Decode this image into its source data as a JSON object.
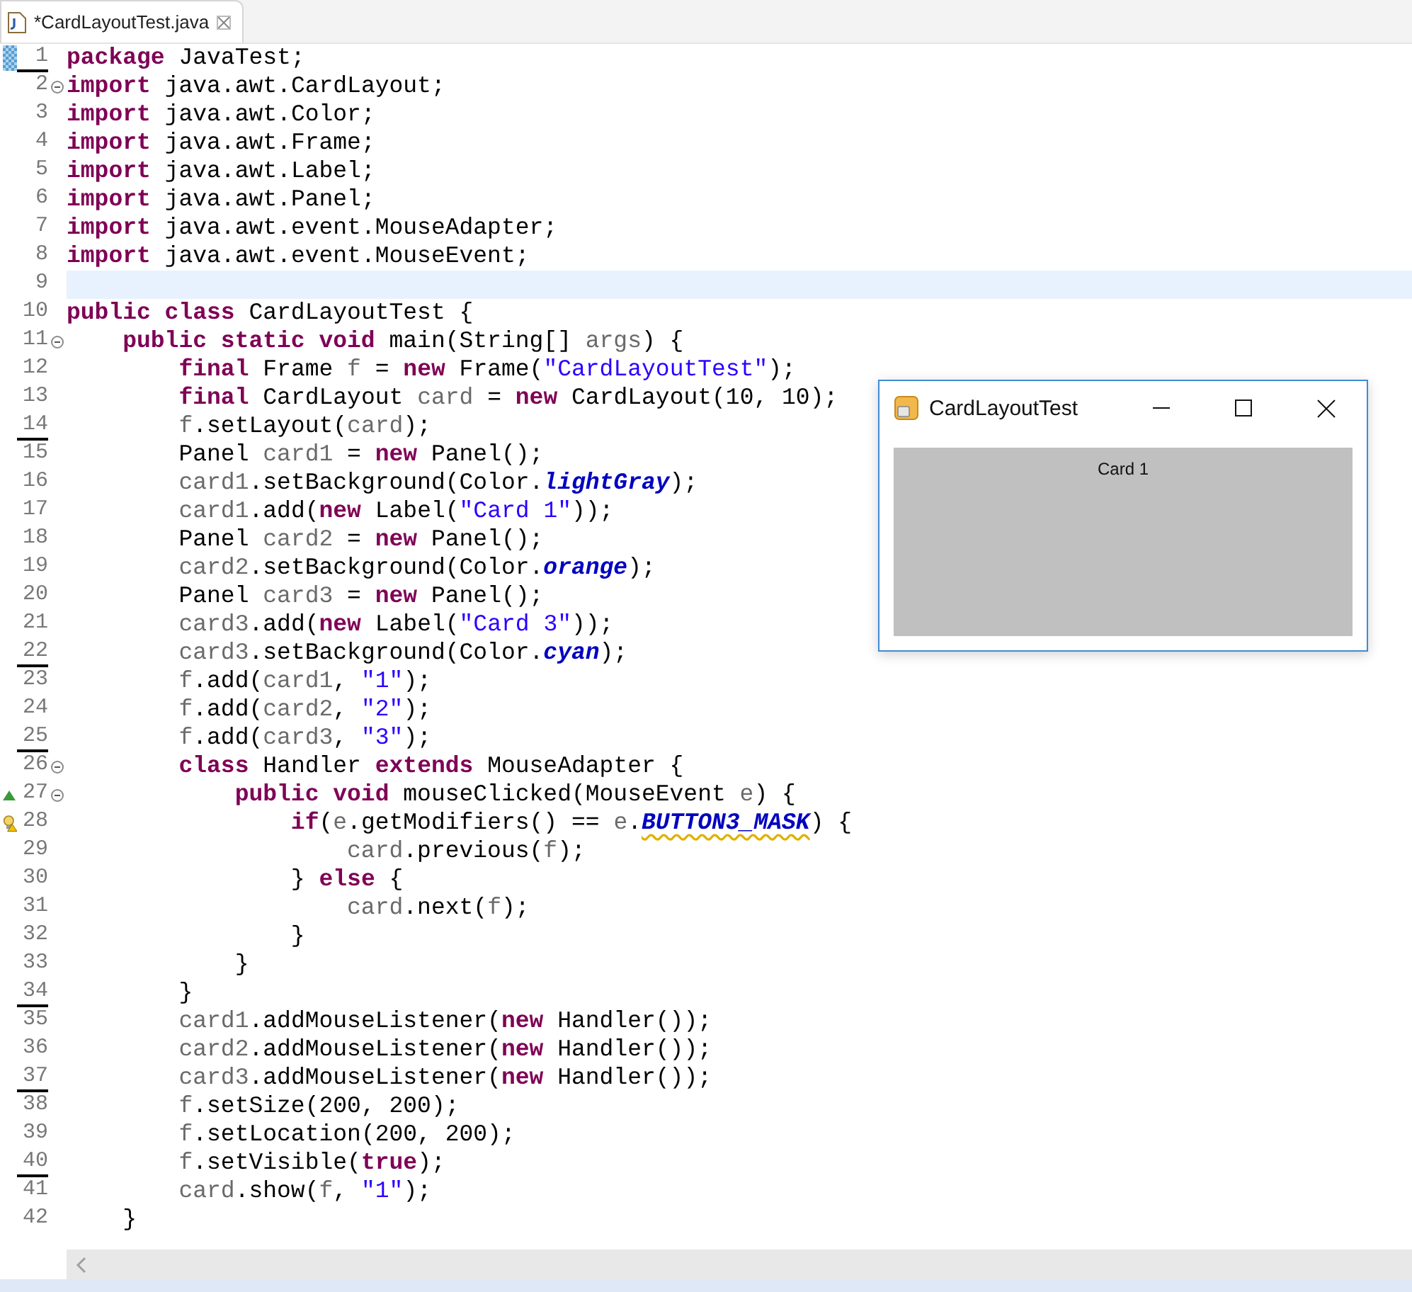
{
  "editor_tab": {
    "title": "*CardLayoutTest.java"
  },
  "lines": [
    {
      "number": "1",
      "underlined": true,
      "fold": false,
      "current": false,
      "marker": {
        "kind": "highlight"
      },
      "tokens": [
        {
          "kind": "keyword",
          "text": "package"
        },
        {
          "kind": "plain",
          "text": " JavaTest;"
        }
      ]
    },
    {
      "number": "2",
      "underlined": false,
      "fold": true,
      "current": false,
      "tokens": [
        {
          "kind": "keyword",
          "text": "import"
        },
        {
          "kind": "plain",
          "text": " java.awt.CardLayout;"
        }
      ]
    },
    {
      "number": "3",
      "underlined": false,
      "fold": false,
      "current": false,
      "tokens": [
        {
          "kind": "keyword",
          "text": "import"
        },
        {
          "kind": "plain",
          "text": " java.awt.Color;"
        }
      ]
    },
    {
      "number": "4",
      "underlined": false,
      "fold": false,
      "current": false,
      "tokens": [
        {
          "kind": "keyword",
          "text": "import"
        },
        {
          "kind": "plain",
          "text": " java.awt.Frame;"
        }
      ]
    },
    {
      "number": "5",
      "underlined": false,
      "fold": false,
      "current": false,
      "tokens": [
        {
          "kind": "keyword",
          "text": "import"
        },
        {
          "kind": "plain",
          "text": " java.awt.Label;"
        }
      ]
    },
    {
      "number": "6",
      "underlined": false,
      "fold": false,
      "current": false,
      "tokens": [
        {
          "kind": "keyword",
          "text": "import"
        },
        {
          "kind": "plain",
          "text": " java.awt.Panel;"
        }
      ]
    },
    {
      "number": "7",
      "underlined": false,
      "fold": false,
      "current": false,
      "tokens": [
        {
          "kind": "keyword",
          "text": "import"
        },
        {
          "kind": "plain",
          "text": " java.awt.event.MouseAdapter;"
        }
      ]
    },
    {
      "number": "8",
      "underlined": false,
      "fold": false,
      "current": false,
      "tokens": [
        {
          "kind": "keyword",
          "text": "import"
        },
        {
          "kind": "plain",
          "text": " java.awt.event.MouseEvent;"
        }
      ]
    },
    {
      "number": "9",
      "underlined": false,
      "fold": false,
      "current": true
    },
    {
      "number": "10",
      "underlined": false,
      "fold": false,
      "current": false,
      "tokens": [
        {
          "kind": "keyword",
          "text": "public class"
        },
        {
          "kind": "plain",
          "text": " CardLayoutTest {"
        }
      ]
    },
    {
      "number": "11",
      "underlined": false,
      "fold": true,
      "current": false,
      "tokens": [
        {
          "kind": "keyword",
          "text": "    public static void"
        },
        {
          "kind": "plain",
          "text": " main(String[] "
        },
        {
          "kind": "local",
          "text": "args"
        },
        {
          "kind": "plain",
          "text": ") {"
        }
      ]
    },
    {
      "number": "12",
      "underlined": false,
      "fold": false,
      "current": false,
      "tokens": [
        {
          "kind": "keyword",
          "text": "        final"
        },
        {
          "kind": "plain",
          "text": " Frame "
        },
        {
          "kind": "local",
          "text": "f"
        },
        {
          "kind": "plain",
          "text": " = "
        },
        {
          "kind": "keyword",
          "text": "new"
        },
        {
          "kind": "plain",
          "text": " Frame("
        },
        {
          "kind": "string",
          "text": "\"CardLayoutTest\""
        },
        {
          "kind": "plain",
          "text": ");"
        }
      ]
    },
    {
      "number": "13",
      "underlined": false,
      "fold": false,
      "current": false,
      "tokens": [
        {
          "kind": "keyword",
          "text": "        final"
        },
        {
          "kind": "plain",
          "text": " CardLayout "
        },
        {
          "kind": "local",
          "text": "card"
        },
        {
          "kind": "plain",
          "text": " = "
        },
        {
          "kind": "keyword",
          "text": "new"
        },
        {
          "kind": "plain",
          "text": " CardLayout(10, 10);"
        }
      ]
    },
    {
      "number": "14",
      "underlined": true,
      "fold": false,
      "current": false,
      "tokens": [
        {
          "kind": "local",
          "text": "        f"
        },
        {
          "kind": "plain",
          "text": ".setLayout("
        },
        {
          "kind": "local",
          "text": "card"
        },
        {
          "kind": "plain",
          "text": ");"
        }
      ]
    },
    {
      "number": "15",
      "underlined": false,
      "fold": false,
      "current": false,
      "tokens": [
        {
          "kind": "plain",
          "text": "        Panel "
        },
        {
          "kind": "local",
          "text": "card1"
        },
        {
          "kind": "plain",
          "text": " = "
        },
        {
          "kind": "keyword",
          "text": "new"
        },
        {
          "kind": "plain",
          "text": " Panel();"
        }
      ]
    },
    {
      "number": "16",
      "underlined": false,
      "fold": false,
      "current": false,
      "tokens": [
        {
          "kind": "local",
          "text": "        card1"
        },
        {
          "kind": "plain",
          "text": ".setBackground(Color."
        },
        {
          "kind": "static",
          "text": "lightGray"
        },
        {
          "kind": "plain",
          "text": ");"
        }
      ]
    },
    {
      "number": "17",
      "underlined": false,
      "fold": false,
      "current": false,
      "tokens": [
        {
          "kind": "local",
          "text": "        card1"
        },
        {
          "kind": "plain",
          "text": ".add("
        },
        {
          "kind": "keyword",
          "text": "new"
        },
        {
          "kind": "plain",
          "text": " Label("
        },
        {
          "kind": "string",
          "text": "\"Card 1\""
        },
        {
          "kind": "plain",
          "text": "));"
        }
      ]
    },
    {
      "number": "18",
      "underlined": false,
      "fold": false,
      "current": false,
      "tokens": [
        {
          "kind": "plain",
          "text": "        Panel "
        },
        {
          "kind": "local",
          "text": "card2"
        },
        {
          "kind": "plain",
          "text": " = "
        },
        {
          "kind": "keyword",
          "text": "new"
        },
        {
          "kind": "plain",
          "text": " Panel();"
        }
      ]
    },
    {
      "number": "19",
      "underlined": false,
      "fold": false,
      "current": false,
      "tokens": [
        {
          "kind": "local",
          "text": "        card2"
        },
        {
          "kind": "plain",
          "text": ".setBackground(Color."
        },
        {
          "kind": "static",
          "text": "orange"
        },
        {
          "kind": "plain",
          "text": ");"
        }
      ]
    },
    {
      "number": "20",
      "underlined": false,
      "fold": false,
      "current": false,
      "tokens": [
        {
          "kind": "plain",
          "text": "        Panel "
        },
        {
          "kind": "local",
          "text": "card3"
        },
        {
          "kind": "plain",
          "text": " = "
        },
        {
          "kind": "keyword",
          "text": "new"
        },
        {
          "kind": "plain",
          "text": " Panel();"
        }
      ]
    },
    {
      "number": "21",
      "underlined": false,
      "fold": false,
      "current": false,
      "tokens": [
        {
          "kind": "local",
          "text": "        card3"
        },
        {
          "kind": "plain",
          "text": ".add("
        },
        {
          "kind": "keyword",
          "text": "new"
        },
        {
          "kind": "plain",
          "text": " Label("
        },
        {
          "kind": "string",
          "text": "\"Card 3\""
        },
        {
          "kind": "plain",
          "text": "));"
        }
      ]
    },
    {
      "number": "22",
      "underlined": true,
      "fold": false,
      "current": false,
      "tokens": [
        {
          "kind": "local",
          "text": "        card3"
        },
        {
          "kind": "plain",
          "text": ".setBackground(Color."
        },
        {
          "kind": "static",
          "text": "cyan"
        },
        {
          "kind": "plain",
          "text": ");"
        }
      ]
    },
    {
      "number": "23",
      "underlined": false,
      "fold": false,
      "current": false,
      "tokens": [
        {
          "kind": "local",
          "text": "        f"
        },
        {
          "kind": "plain",
          "text": ".add("
        },
        {
          "kind": "local",
          "text": "card1"
        },
        {
          "kind": "plain",
          "text": ", "
        },
        {
          "kind": "string",
          "text": "\"1\""
        },
        {
          "kind": "plain",
          "text": ");"
        }
      ]
    },
    {
      "number": "24",
      "underlined": false,
      "fold": false,
      "current": false,
      "tokens": [
        {
          "kind": "local",
          "text": "        f"
        },
        {
          "kind": "plain",
          "text": ".add("
        },
        {
          "kind": "local",
          "text": "card2"
        },
        {
          "kind": "plain",
          "text": ", "
        },
        {
          "kind": "string",
          "text": "\"2\""
        },
        {
          "kind": "plain",
          "text": ");"
        }
      ]
    },
    {
      "number": "25",
      "underlined": true,
      "fold": false,
      "current": false,
      "tokens": [
        {
          "kind": "local",
          "text": "        f"
        },
        {
          "kind": "plain",
          "text": ".add("
        },
        {
          "kind": "local",
          "text": "card3"
        },
        {
          "kind": "plain",
          "text": ", "
        },
        {
          "kind": "string",
          "text": "\"3\""
        },
        {
          "kind": "plain",
          "text": ");"
        }
      ]
    },
    {
      "number": "26",
      "underlined": false,
      "fold": true,
      "current": false,
      "tokens": [
        {
          "kind": "keyword",
          "text": "        class"
        },
        {
          "kind": "plain",
          "text": " Handler "
        },
        {
          "kind": "keyword",
          "text": "extends"
        },
        {
          "kind": "plain",
          "text": " MouseAdapter {"
        }
      ]
    },
    {
      "number": "27",
      "underlined": false,
      "fold": true,
      "current": false,
      "marker": {
        "kind": "override"
      },
      "tokens": [
        {
          "kind": "keyword",
          "text": "            public void"
        },
        {
          "kind": "plain",
          "text": " mouseClicked(MouseEvent "
        },
        {
          "kind": "local",
          "text": "e"
        },
        {
          "kind": "plain",
          "text": ") {"
        }
      ]
    },
    {
      "number": "28",
      "underlined": false,
      "fold": false,
      "current": false,
      "marker": {
        "kind": "warning"
      },
      "tokens": [
        {
          "kind": "keyword",
          "text": "                if"
        },
        {
          "kind": "plain",
          "text": "("
        },
        {
          "kind": "local",
          "text": "e"
        },
        {
          "kind": "plain",
          "text": ".getModifiers() == "
        },
        {
          "kind": "local",
          "text": "e"
        },
        {
          "kind": "plain",
          "text": "."
        },
        {
          "kind": "static-warning",
          "text": "BUTTON3_MASK"
        },
        {
          "kind": "plain",
          "text": ") {"
        }
      ]
    },
    {
      "number": "29",
      "underlined": false,
      "fold": false,
      "current": false,
      "tokens": [
        {
          "kind": "local",
          "text": "                    card"
        },
        {
          "kind": "plain",
          "text": ".previous("
        },
        {
          "kind": "local",
          "text": "f"
        },
        {
          "kind": "plain",
          "text": ");"
        }
      ]
    },
    {
      "number": "30",
      "underlined": false,
      "fold": false,
      "current": false,
      "tokens": [
        {
          "kind": "plain",
          "text": "                } "
        },
        {
          "kind": "keyword",
          "text": "else"
        },
        {
          "kind": "plain",
          "text": " {"
        }
      ]
    },
    {
      "number": "31",
      "underlined": false,
      "fold": false,
      "current": false,
      "tokens": [
        {
          "kind": "local",
          "text": "                    card"
        },
        {
          "kind": "plain",
          "text": ".next("
        },
        {
          "kind": "local",
          "text": "f"
        },
        {
          "kind": "plain",
          "text": ");"
        }
      ]
    },
    {
      "number": "32",
      "underlined": false,
      "fold": false,
      "current": false,
      "tokens": [
        {
          "kind": "plain",
          "text": "                }"
        }
      ]
    },
    {
      "number": "33",
      "underlined": false,
      "fold": false,
      "current": false,
      "tokens": [
        {
          "kind": "plain",
          "text": "            }"
        }
      ]
    },
    {
      "number": "34",
      "underlined": true,
      "fold": false,
      "current": false,
      "tokens": [
        {
          "kind": "plain",
          "text": "        }"
        }
      ]
    },
    {
      "number": "35",
      "underlined": false,
      "fold": false,
      "current": false,
      "tokens": [
        {
          "kind": "local",
          "text": "        card1"
        },
        {
          "kind": "plain",
          "text": ".addMouseListener("
        },
        {
          "kind": "keyword",
          "text": "new"
        },
        {
          "kind": "plain",
          "text": " Handler());"
        }
      ]
    },
    {
      "number": "36",
      "underlined": false,
      "fold": false,
      "current": false,
      "tokens": [
        {
          "kind": "local",
          "text": "        card2"
        },
        {
          "kind": "plain",
          "text": ".addMouseListener("
        },
        {
          "kind": "keyword",
          "text": "new"
        },
        {
          "kind": "plain",
          "text": " Handler());"
        }
      ]
    },
    {
      "number": "37",
      "underlined": true,
      "fold": false,
      "current": false,
      "tokens": [
        {
          "kind": "local",
          "text": "        card3"
        },
        {
          "kind": "plain",
          "text": ".addMouseListener("
        },
        {
          "kind": "keyword",
          "text": "new"
        },
        {
          "kind": "plain",
          "text": " Handler());"
        }
      ]
    },
    {
      "number": "38",
      "underlined": false,
      "fold": false,
      "current": false,
      "tokens": [
        {
          "kind": "local",
          "text": "        f"
        },
        {
          "kind": "plain",
          "text": ".setSize(200, 200);"
        }
      ]
    },
    {
      "number": "39",
      "underlined": false,
      "fold": false,
      "current": false,
      "tokens": [
        {
          "kind": "local",
          "text": "        f"
        },
        {
          "kind": "plain",
          "text": ".setLocation(200, 200);"
        }
      ]
    },
    {
      "number": "40",
      "underlined": true,
      "fold": false,
      "current": false,
      "tokens": [
        {
          "kind": "local",
          "text": "        f"
        },
        {
          "kind": "plain",
          "text": ".setVisible("
        },
        {
          "kind": "keyword",
          "text": "true"
        },
        {
          "kind": "plain",
          "text": ");"
        }
      ]
    },
    {
      "number": "41",
      "underlined": false,
      "fold": false,
      "current": false,
      "tokens": [
        {
          "kind": "local",
          "text": "        card"
        },
        {
          "kind": "plain",
          "text": ".show("
        },
        {
          "kind": "local",
          "text": "f"
        },
        {
          "kind": "plain",
          "text": ", "
        },
        {
          "kind": "string",
          "text": "\"1\""
        },
        {
          "kind": "plain",
          "text": ");"
        }
      ]
    },
    {
      "number": "42",
      "underlined": false,
      "fold": false,
      "current": false,
      "tokens": [
        {
          "kind": "plain",
          "text": "    }"
        }
      ]
    }
  ],
  "app_window": {
    "title": "CardLayoutTest",
    "card_label": "Card 1"
  }
}
